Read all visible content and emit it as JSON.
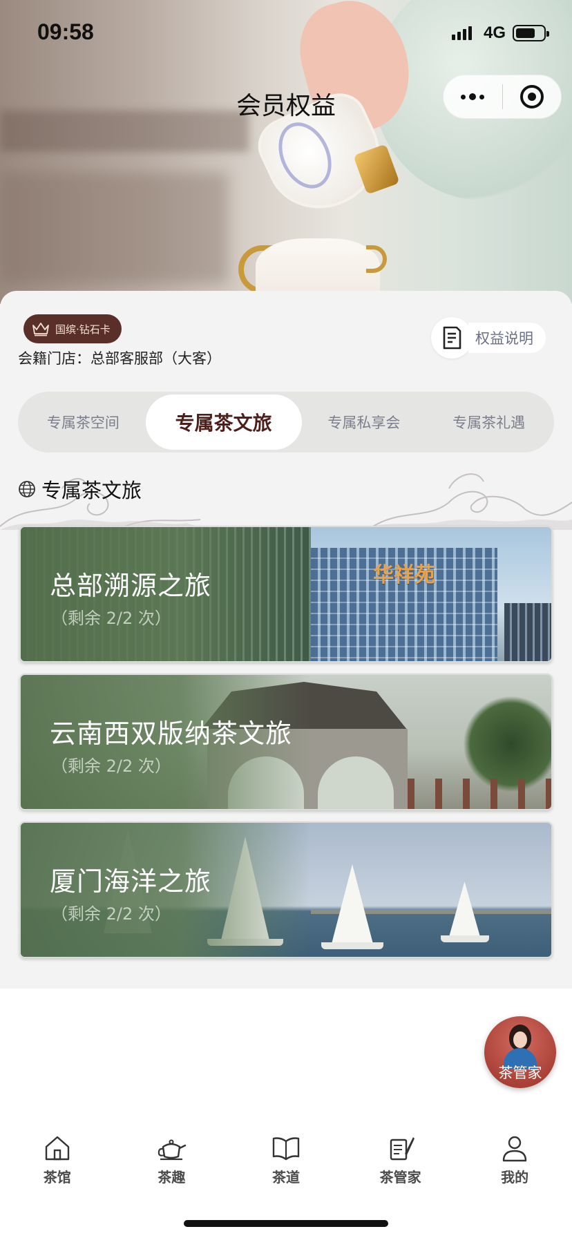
{
  "status_bar": {
    "time": "09:58",
    "network": "4G"
  },
  "header": {
    "title": "会员权益"
  },
  "membership": {
    "card_label": "国缤·钻石卡",
    "store_line": "会籍门店：总部客服部（大客）",
    "rights_button": "权益说明"
  },
  "tabs": [
    {
      "label": "专属茶空间",
      "active": false
    },
    {
      "label": "专属茶文旅",
      "active": true
    },
    {
      "label": "专属私享会",
      "active": false
    },
    {
      "label": "专属茶礼遇",
      "active": false
    }
  ],
  "section": {
    "title": "专属茶文旅"
  },
  "trips": [
    {
      "name": "总部溯源之旅",
      "remaining": "（剩余 2/2 次）",
      "sign_text": "华祥苑"
    },
    {
      "name": "云南西双版纳茶文旅",
      "remaining": "（剩余 2/2 次）"
    },
    {
      "name": "厦门海洋之旅",
      "remaining": "（剩余 2/2 次）"
    }
  ],
  "floating_button": {
    "label": "茶管家"
  },
  "bottom_nav": [
    {
      "label": "茶馆",
      "icon": "house-icon"
    },
    {
      "label": "茶趣",
      "icon": "teapot-icon"
    },
    {
      "label": "茶道",
      "icon": "book-icon"
    },
    {
      "label": "茶管家",
      "icon": "tea-butler-icon"
    },
    {
      "label": "我的",
      "icon": "person-icon"
    }
  ],
  "colors": {
    "accent": "#5a2f2a",
    "active_tab_text": "#4c1f1b",
    "panel_bg": "#f2f3f2"
  }
}
